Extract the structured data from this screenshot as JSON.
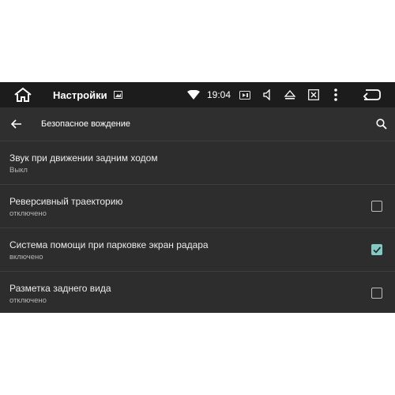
{
  "status_bar": {
    "title": "Настройки",
    "time": "19:04",
    "icons": [
      "home-icon",
      "image-icon",
      "wifi-icon",
      "media-icon",
      "volume-icon",
      "eject-icon",
      "close-box-icon",
      "overflow-menu-icon",
      "back-nav-icon"
    ]
  },
  "action_bar": {
    "title": "Безопасное вождение",
    "icons": [
      "back-arrow-icon",
      "search-icon"
    ]
  },
  "settings": [
    {
      "title": "Звук при движении задним ходом",
      "summary": "Выкл",
      "has_checkbox": false
    },
    {
      "title": "Реверсивный траекторию",
      "summary": "отключено",
      "has_checkbox": true,
      "checked": false
    },
    {
      "title": "Система помощи при парковке экран радара",
      "summary": "включено",
      "has_checkbox": true,
      "checked": true
    },
    {
      "title": "Разметка заднего вида",
      "summary": "отключено",
      "has_checkbox": true,
      "checked": false
    }
  ],
  "colors": {
    "status_bar_bg": "#1c1c1c",
    "background": "#2d2d2d",
    "accent_checkbox": "#80cbc4"
  }
}
